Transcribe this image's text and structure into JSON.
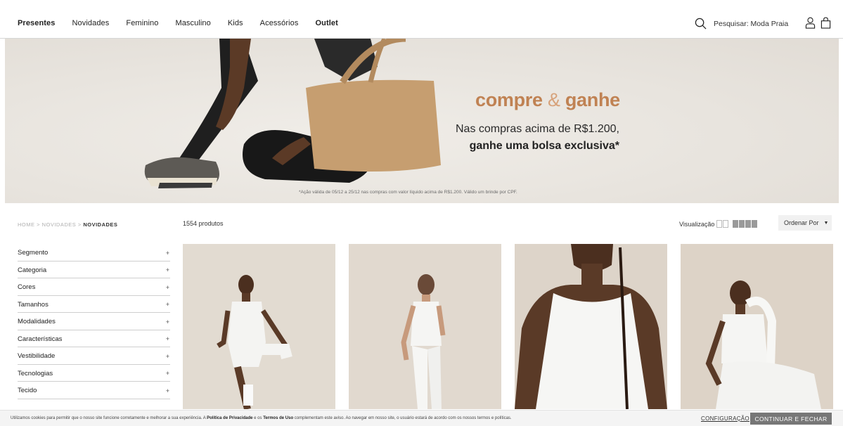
{
  "header": {
    "nav": [
      {
        "label": "Presentes",
        "bold": true
      },
      {
        "label": "Novidades",
        "bold": false
      },
      {
        "label": "Feminino",
        "bold": false
      },
      {
        "label": "Masculino",
        "bold": false
      },
      {
        "label": "Kids",
        "bold": false
      },
      {
        "label": "Acessórios",
        "bold": false
      },
      {
        "label": "Outlet",
        "bold": true
      }
    ],
    "search_placeholder": "Pesquisar: Moda Praia",
    "icons": [
      "search-icon",
      "user-icon",
      "bag-icon"
    ]
  },
  "banner": {
    "title_part1": "compre",
    "title_amp": "&",
    "title_part2": "ganhe",
    "line1": "Nas compras acima de R$1.200,",
    "line2": "ganhe uma bolsa exclusiva*",
    "note": "*Ação válida de 05/12 a 25/12 nas compras com valor líquido acima de R$1.200. Válido um brinde por CPF.",
    "title_color": "#c08253"
  },
  "listing": {
    "breadcrumb": [
      "HOME",
      "NOVIDADES",
      "NOVIDADES"
    ],
    "breadcrumb_sep": ">",
    "count": "1554 produtos",
    "view_label": "Visualização",
    "sort_label": "Ordenar Por"
  },
  "filters": [
    {
      "label": "Segmento"
    },
    {
      "label": "Categoria"
    },
    {
      "label": "Cores"
    },
    {
      "label": "Tamanhos"
    },
    {
      "label": "Modalidades"
    },
    {
      "label": "Características"
    },
    {
      "label": "Vestibilidade"
    },
    {
      "label": "Tecnologias"
    },
    {
      "label": "Tecido"
    }
  ],
  "filter_expand_symbol": "+",
  "products": [
    {
      "image": "model-white-jumpsuit-kneeling"
    },
    {
      "image": "model-white-tank-leggings-standing"
    },
    {
      "image": "model-white-crop-top-closeup"
    },
    {
      "image": "model-white-set-seated"
    }
  ],
  "cookie": {
    "text_a": "Utilizamos cookies para permitir que o nosso site funcione corretamente e melhorar a sua experiência. A ",
    "privacy": "Política de Privacidade",
    "text_b": " e os ",
    "terms": "Termos de Uso",
    "text_c": " complementam este aviso. Ao navegar em nosso site, o usuário estará de acordo com os nossos termos e políticas.",
    "config": "CONFIGURAÇÃO",
    "accept": "CONTINUAR E FECHAR"
  }
}
